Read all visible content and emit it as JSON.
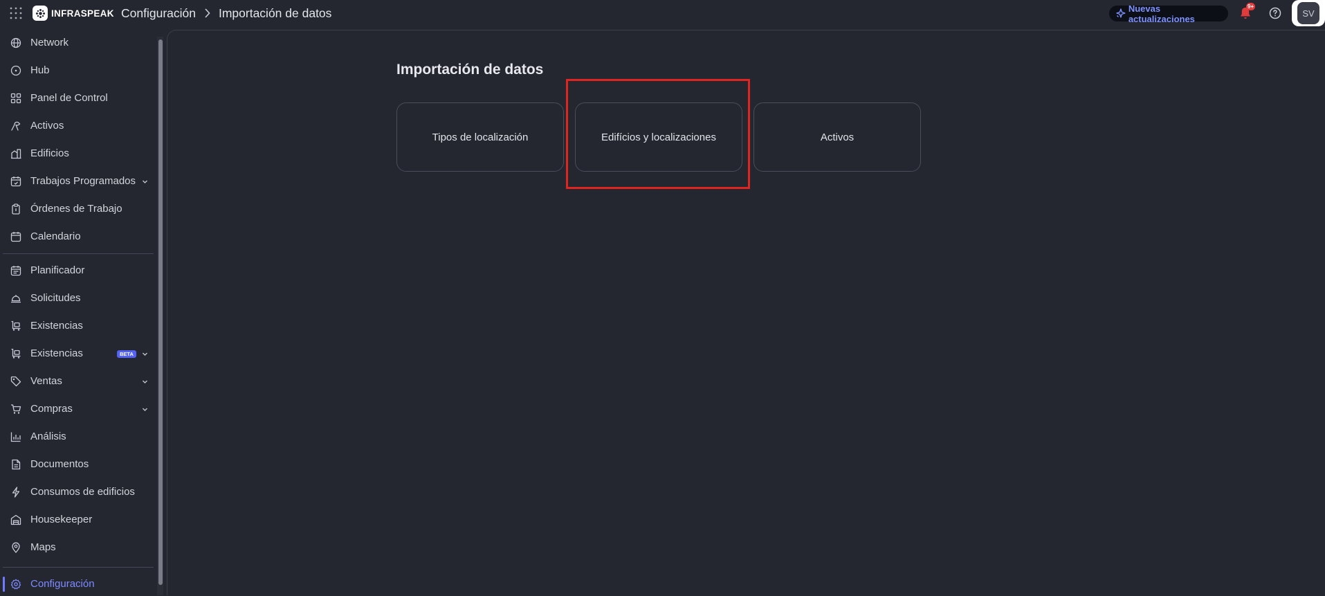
{
  "brand": {
    "name": "INFRASPEAK"
  },
  "breadcrumb": {
    "parent": "Configuración",
    "current": "Importación de datos"
  },
  "header": {
    "updates_label": "Nuevas actualizaciones",
    "notifications_count": "9+",
    "avatar_initials": "SV"
  },
  "sidebar": {
    "items": [
      {
        "label": "Network",
        "icon": "globe-icon"
      },
      {
        "label": "Hub",
        "icon": "hub-icon"
      },
      {
        "label": "Panel de Control",
        "icon": "dashboard-icon"
      },
      {
        "label": "Activos",
        "icon": "assets-icon"
      },
      {
        "label": "Edificios",
        "icon": "building-icon"
      },
      {
        "label": "Trabajos Programados",
        "icon": "calendar-repeat-icon"
      },
      {
        "label": "Órdenes de Trabajo",
        "icon": "clipboard-icon"
      },
      {
        "label": "Calendario",
        "icon": "calendar-icon"
      },
      {
        "label": "Planificador",
        "icon": "planner-icon"
      },
      {
        "label": "Solicitudes",
        "icon": "bell-service-icon"
      },
      {
        "label": "Existencias",
        "icon": "stock-icon"
      },
      {
        "label": "Existencias",
        "icon": "stock-icon",
        "badge": "BETA"
      },
      {
        "label": "Ventas",
        "icon": "tag-icon"
      },
      {
        "label": "Compras",
        "icon": "cart-icon"
      },
      {
        "label": "Análisis",
        "icon": "chart-icon"
      },
      {
        "label": "Documentos",
        "icon": "document-icon"
      },
      {
        "label": "Consumos de edificios",
        "icon": "bolt-icon"
      },
      {
        "label": "Housekeeper",
        "icon": "housekeeper-icon"
      },
      {
        "label": "Maps",
        "icon": "map-pin-icon"
      },
      {
        "label": "Configuración",
        "icon": "gear-icon",
        "active": true
      }
    ]
  },
  "main": {
    "title": "Importación de datos",
    "cards": [
      {
        "label": "Tipos de localización"
      },
      {
        "label": "Edifícios y localizaciones",
        "highlighted": true
      },
      {
        "label": "Activos"
      }
    ]
  },
  "colors": {
    "accent": "#6e7bff",
    "highlight": "#e0241f",
    "background": "#242630",
    "updates_text": "#7e93ff"
  }
}
